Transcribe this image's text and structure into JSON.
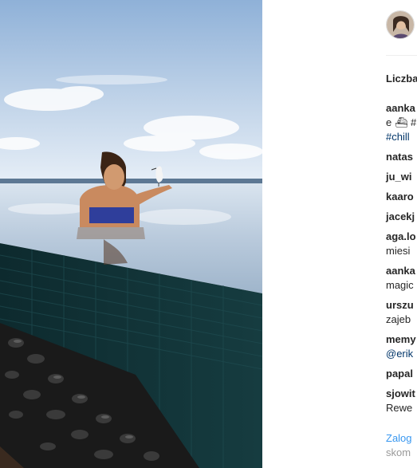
{
  "post": {
    "likes_label": "Liczba",
    "comments": [
      {
        "user": "aanka",
        "text": "e ⛴ #",
        "text2": "#chill"
      },
      {
        "user": "natas",
        "text": ""
      },
      {
        "user": "ju_wi",
        "text": ""
      },
      {
        "user": "kaaro",
        "text": ""
      },
      {
        "user": "jacekj",
        "text": ""
      },
      {
        "user": "aga.lo",
        "text": "miesi"
      },
      {
        "user": "aanka",
        "text": "magic"
      },
      {
        "user": "urszu",
        "text": "zajeb"
      },
      {
        "user": "memy",
        "text": "@erik"
      },
      {
        "user": "papal",
        "text": ""
      },
      {
        "user": "sjowit",
        "text": "Rewe"
      }
    ],
    "login_link": "Zalog",
    "login_text": "skom"
  },
  "colors": {
    "link": "#3897f0",
    "hashtag": "#003569",
    "text": "#262626"
  }
}
